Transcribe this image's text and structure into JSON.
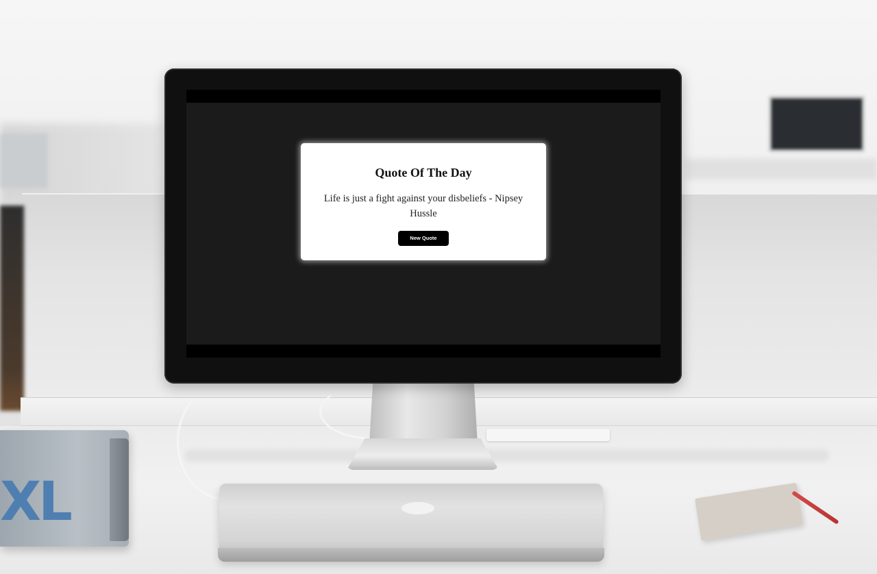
{
  "app": {
    "title": "Quote Of The Day",
    "quote": "Life is just a fight against your disbeliefs - Nipsey Hussle",
    "button_label": "New Quote"
  },
  "theme": {
    "app_background": "#1b1b1b",
    "card_background": "#ffffff",
    "button_background": "#000000",
    "button_text": "#ffffff"
  },
  "scene": {
    "book_label": "XL"
  }
}
